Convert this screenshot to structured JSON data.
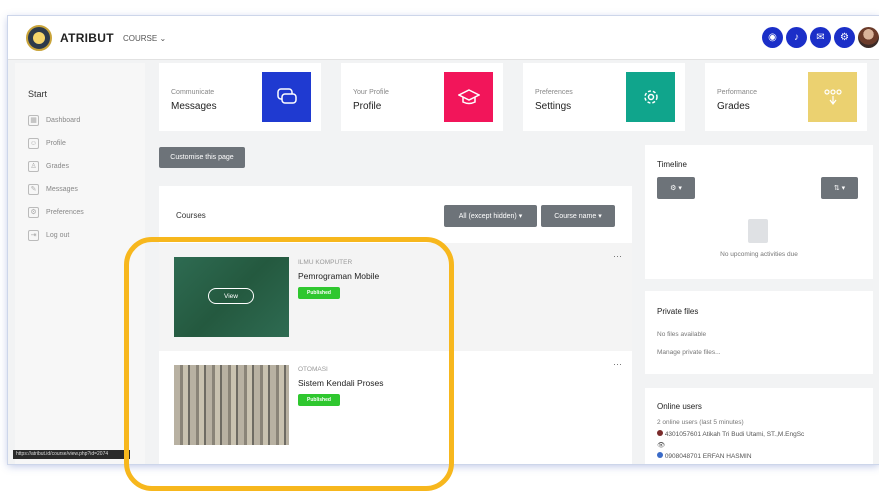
{
  "navbar": {
    "brand": "ATRIBUT",
    "course_menu": "COURSE",
    "icons": [
      "eye-icon",
      "bell-icon",
      "chat-icon",
      "gear-icon"
    ]
  },
  "sidebar": {
    "start": "Start",
    "items": [
      {
        "label": "Dashboard",
        "icon": "dashboard-icon"
      },
      {
        "label": "Profile",
        "icon": "profile-icon"
      },
      {
        "label": "Grades",
        "icon": "grades-icon"
      },
      {
        "label": "Messages",
        "icon": "messages-icon"
      },
      {
        "label": "Preferences",
        "icon": "preferences-icon"
      },
      {
        "label": "Log out",
        "icon": "logout-icon"
      }
    ]
  },
  "tiles": [
    {
      "sub": "Communicate",
      "title": "Messages",
      "color": "#1f3ad1",
      "icon": "chat-icon"
    },
    {
      "sub": "Your Profile",
      "title": "Profile",
      "color": "#f2155a",
      "icon": "graduation-cap-icon"
    },
    {
      "sub": "Preferences",
      "title": "Settings",
      "color": "#10a58c",
      "icon": "gear-icon"
    },
    {
      "sub": "Performance",
      "title": "Grades",
      "color": "#ebd170",
      "icon": "grades-icon"
    }
  ],
  "customise_button": "Customise this page",
  "courses": {
    "label": "Courses",
    "filter": "All (except hidden)",
    "sort": "Course name",
    "items": [
      {
        "category": "ILMU KOMPUTER",
        "name": "Pemrograman Mobile",
        "status": "Published",
        "view": "View"
      },
      {
        "category": "OTOMASI",
        "name": "Sistem Kendali Proses",
        "status": "Published"
      }
    ]
  },
  "timeline": {
    "title": "Timeline",
    "empty": "No upcoming activities due"
  },
  "private_files": {
    "title": "Private files",
    "empty": "No files available",
    "manage": "Manage private files..."
  },
  "online_users": {
    "title": "Online users",
    "summary": "2 online users (last 5 minutes)",
    "users": [
      "4301057601 Atikah Tri Budi Utami, ST.,M.EngSc",
      "0908048701 ERFAN HASMIN"
    ]
  },
  "status_url": "https://atribut.id/course/view.php?id=2074",
  "highlight_color": "#f7b71d"
}
